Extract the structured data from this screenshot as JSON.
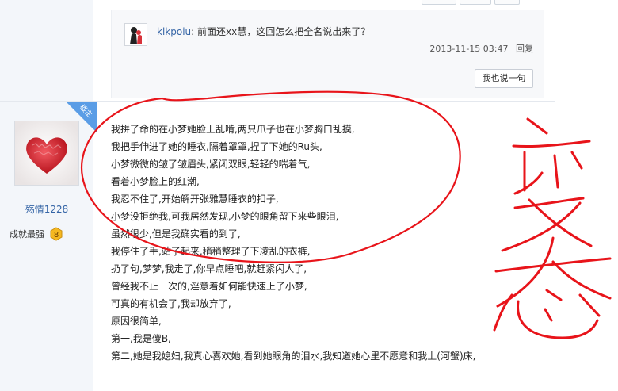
{
  "reply": {
    "username": "klkpoiu",
    "separator": ": ",
    "text": "前面还xx慧，这回怎么把全名说出来了？",
    "timestamp": "2013-11-15 03:47",
    "reply_link": "回复",
    "say_button": "我也说一句"
  },
  "author": {
    "badge": "楼主",
    "name": "殇情1228",
    "rank": "成就最强",
    "level": "8"
  },
  "post": {
    "lines": [
      "我拼了命的在小梦她脸上乱啃,两只爪子也在小梦胸口乱摸,",
      "我把手伸进了她的睡衣,隔着罩罩,捏了下她的Ru头,",
      "小梦微微的皱了皱眉头,紧闭双眼,轻轻的喘着气,",
      "看着小梦脸上的红潮,",
      "我忍不住了,开始解开张雅慧睡衣的扣子,",
      "小梦没拒绝我,可我居然发现,小梦的眼角留下来些眼泪,",
      "虽然很少,但是我确实看的到了,",
      "我停住了手,站了起来,稍稍整理了下凌乱的衣裤,",
      "扔了句,梦梦,我走了,你早点睡吧,就赶紧闪人了,",
      "曾经我不止一次的,淫意着如何能快速上了小梦,",
      "可真的有机会了,我却放弃了,",
      "原因很简单,",
      "第一,我是傻B,",
      "第二,她是我媳妇,我真心喜欢她,看到她眼角的泪水,我知道她心里不愿意和我上(河蟹)床,"
    ]
  },
  "colors": {
    "annotation_red": "#e8141a",
    "link_blue": "#3565a6",
    "badge_blue": "#5a9de6"
  }
}
